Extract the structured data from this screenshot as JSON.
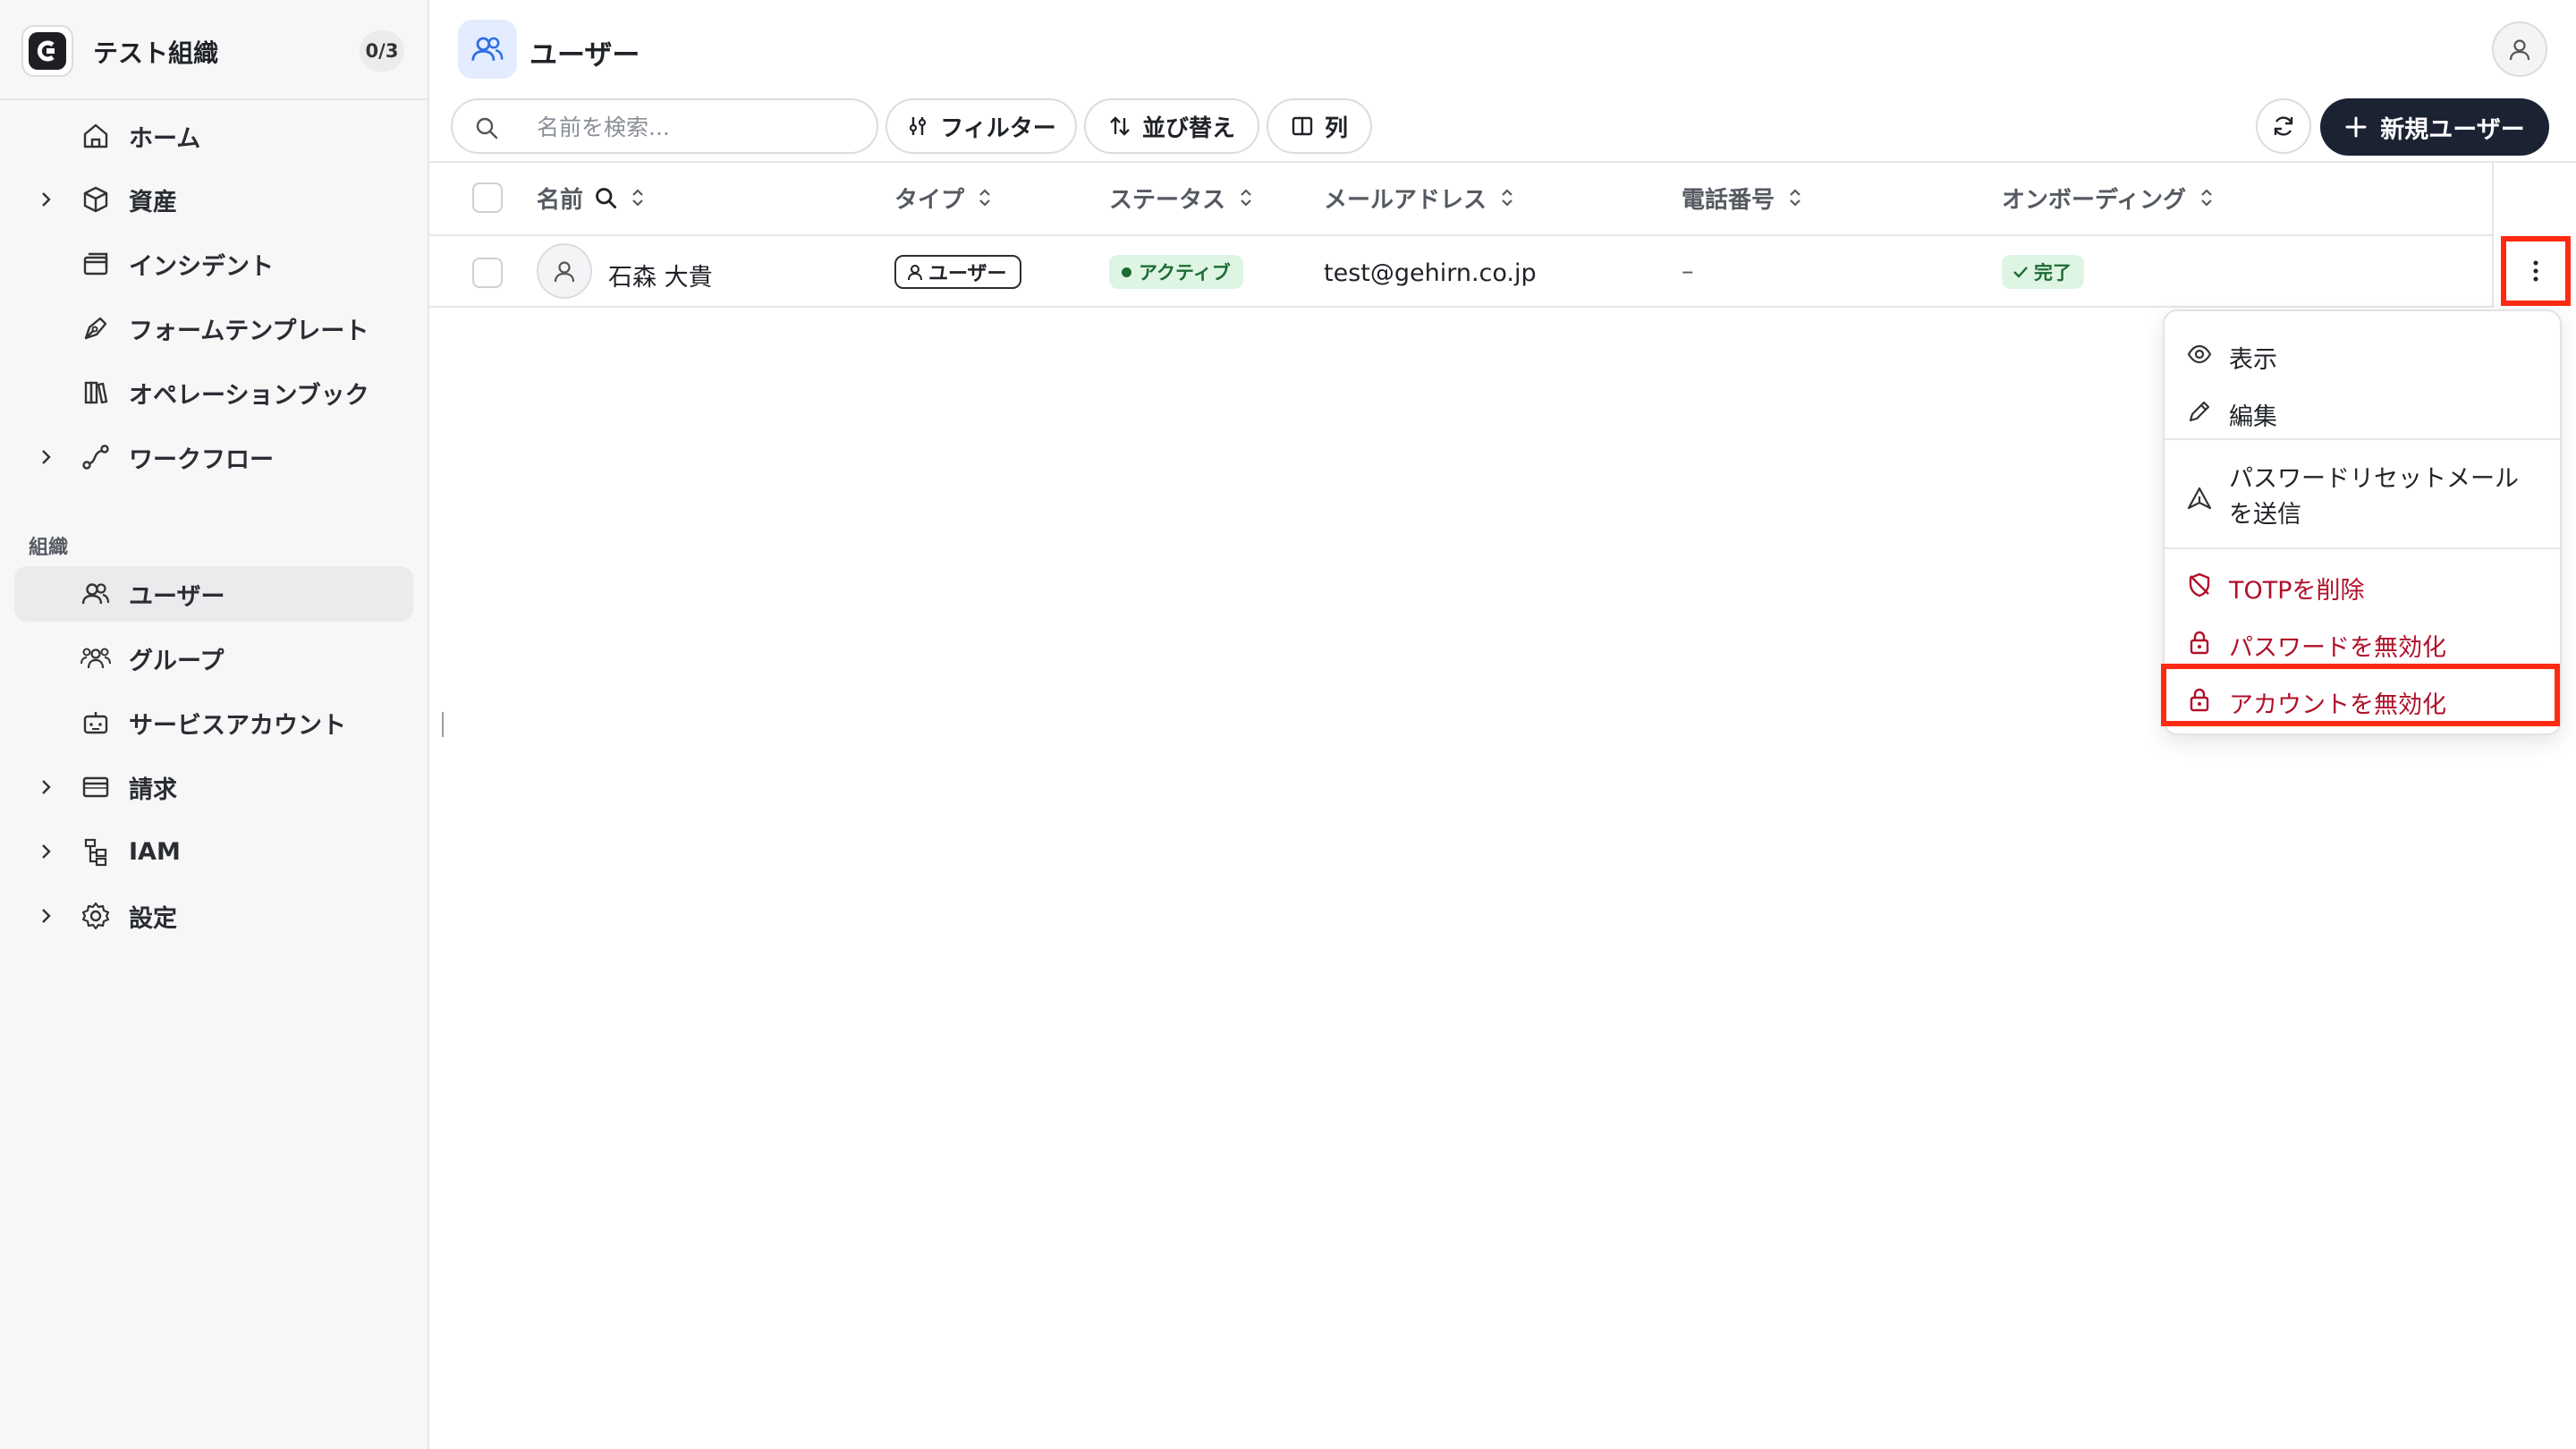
{
  "org": {
    "name": "テスト組織",
    "count": "0/3"
  },
  "sidebar": {
    "items": [
      {
        "label": "ホーム"
      },
      {
        "label": "資産"
      },
      {
        "label": "インシデント"
      },
      {
        "label": "フォームテンプレート"
      },
      {
        "label": "オペレーションブック"
      },
      {
        "label": "ワークフロー"
      }
    ],
    "section": "組織",
    "org_items": [
      {
        "label": "ユーザー"
      },
      {
        "label": "グループ"
      },
      {
        "label": "サービスアカウント"
      },
      {
        "label": "請求"
      },
      {
        "label": "IAM"
      },
      {
        "label": "設定"
      }
    ]
  },
  "header": {
    "title": "ユーザー"
  },
  "toolbar": {
    "search_placeholder": "名前を検索...",
    "filter_label": "フィルター",
    "sort_label": "並び替え",
    "columns_label": "列",
    "new_user_label": "新規ユーザー"
  },
  "table": {
    "columns": [
      "名前",
      "タイプ",
      "ステータス",
      "メールアドレス",
      "電話番号",
      "オンボーディング"
    ],
    "rows": [
      {
        "name": "石森 大貴",
        "type": "ユーザー",
        "status": "アクティブ",
        "email": "test@gehirn.co.jp",
        "phone": "–",
        "onboarding": "完了"
      }
    ]
  },
  "menu": {
    "view": "表示",
    "edit": "編集",
    "reset_password": "パスワードリセットメールを送信",
    "delete_totp": "TOTPを削除",
    "disable_password": "パスワードを無効化",
    "disable_account": "アカウントを無効化"
  },
  "colors": {
    "accent_dark": "#1b2333",
    "danger": "#b0102a",
    "success_bg": "#dff5e4",
    "highlight": "#ff2a12"
  }
}
